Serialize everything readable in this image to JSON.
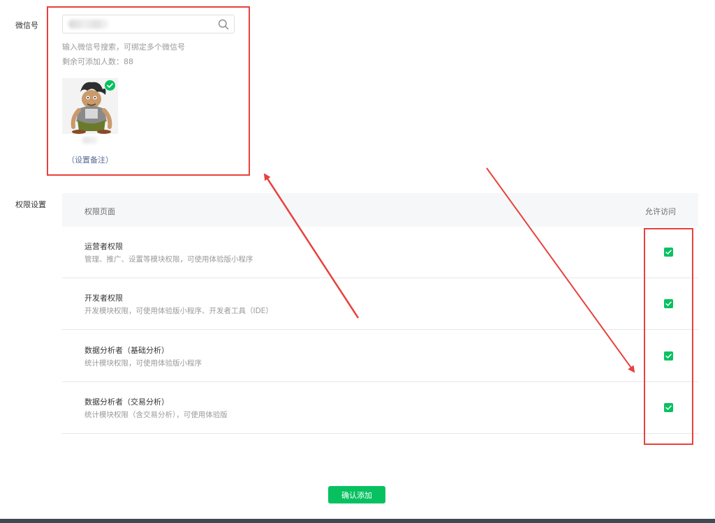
{
  "wechat": {
    "label": "微信号",
    "search_placeholder": "",
    "hint": "输入微信号搜索，可绑定多个微信号",
    "remaining_label": "剩余可添加人数：88",
    "remark_link": "（设置备注）"
  },
  "permissions": {
    "label": "权限设置",
    "col_page": "权限页面",
    "col_allow": "允许访问",
    "rows": [
      {
        "title": "运营者权限",
        "desc": "管理、推广、设置等模块权限，可使用体验版小程序",
        "allowed": true
      },
      {
        "title": "开发者权限",
        "desc": "开发模块权限，可使用体验版小程序、开发者工具（IDE）",
        "allowed": true
      },
      {
        "title": "数据分析者（基础分析）",
        "desc": "统计模块权限，可使用体验版小程序",
        "allowed": true
      },
      {
        "title": "数据分析者（交易分析）",
        "desc": "统计模块权限（含交易分析），可使用体验版",
        "allowed": true
      }
    ]
  },
  "confirm_button": "确认添加",
  "colors": {
    "accent_green": "#07c160",
    "annotation_red": "#e8403c",
    "link_blue": "#576b95"
  }
}
